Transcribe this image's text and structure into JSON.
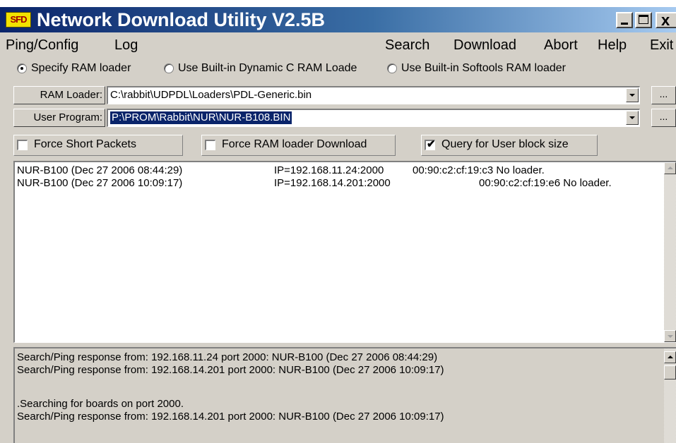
{
  "window": {
    "title": "Network Download Utility V2.5B",
    "logo_text": "SFD",
    "close_glyph": "x"
  },
  "menu": {
    "items": [
      "Ping/Config",
      "Log",
      "Search",
      "Download",
      "Abort",
      "Help",
      "Exit"
    ]
  },
  "loader_options": [
    {
      "label": "Specify RAM loader",
      "checked": true
    },
    {
      "label": "Use Built-in Dynamic C RAM Loade",
      "checked": false
    },
    {
      "label": "Use Built-in Softools  RAM loader",
      "checked": false
    }
  ],
  "ram_loader": {
    "label": "RAM Loader:",
    "value": "C:\\rabbit\\UDPDL\\Loaders\\PDL-Generic.bin",
    "browse_label": "..."
  },
  "user_program": {
    "label": "User Program:",
    "value": "P:\\PROM\\Rabbit\\NUR\\NUR-B108.BIN",
    "browse_label": "..."
  },
  "options": {
    "force_short_packets": {
      "label": "Force Short Packets",
      "checked": false
    },
    "force_ram_loader_download": {
      "label": "Force RAM loader Download",
      "checked": false
    },
    "query_user_block_size": {
      "label": "Query for User block size",
      "checked": true
    },
    "check_glyph": "✔"
  },
  "devices": [
    {
      "name": "NUR-B100 (Dec 27 2006 08:44:29)",
      "ip": "IP=192.168.11.24:2000",
      "mac_status": "00:90:c2:cf:19:c3 No loader."
    },
    {
      "name": "NUR-B100 (Dec 27 2006 10:09:17)",
      "ip": "IP=192.168.14.201:2000",
      "mac_status": "00:90:c2:cf:19:e6 No loader."
    }
  ],
  "log_lines": [
    "Search/Ping response from:  192.168.11.24 port 2000: NUR-B100 (Dec 27 2006 08:44:29)",
    "Search/Ping response from:  192.168.14.201 port 2000: NUR-B100 (Dec 27 2006 10:09:17)",
    "",
    ".Searching for boards on port 2000.",
    "Search/Ping response from:  192.168.14.201 port 2000: NUR-B100 (Dec 27 2006 10:09:17)"
  ],
  "colors": {
    "title_bar_start": "#0a246a",
    "title_bar_end": "#a6caf0",
    "selection": "#0a246a",
    "face": "#d4d0c8"
  }
}
